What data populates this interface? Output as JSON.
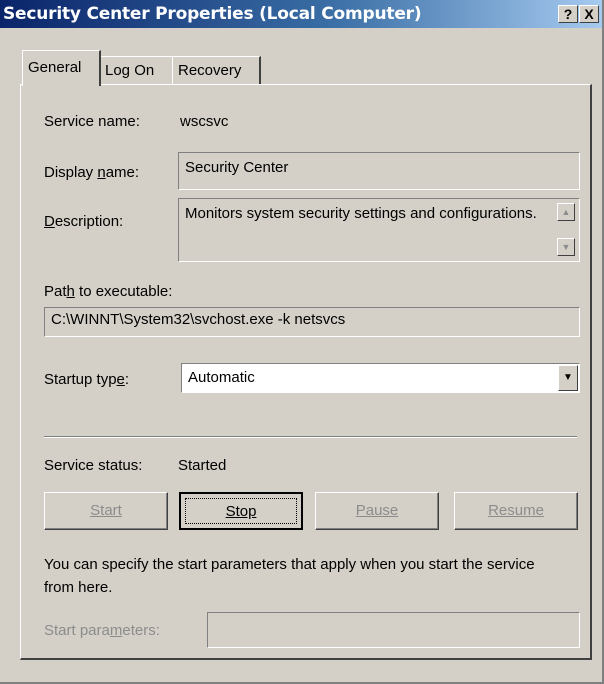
{
  "window": {
    "title": "Security Center Properties (Local Computer)",
    "help_button": "?",
    "close_button": "X"
  },
  "tabs": [
    {
      "label": "General",
      "active": true
    },
    {
      "label": "Log On",
      "active": false
    },
    {
      "label": "Recovery",
      "active": false
    }
  ],
  "general": {
    "service_name_label": "Service name:",
    "service_name_value": "wscsvc",
    "display_name_label": "Display name:",
    "display_name_value": "Security Center",
    "description_label": "Description:",
    "description_value": "Monitors system security settings and configurations.",
    "path_label": "Path to executable:",
    "path_value": "C:\\WINNT\\System32\\svchost.exe -k netsvcs",
    "startup_type_label": "Startup type:",
    "startup_type_value": "Automatic",
    "service_status_label": "Service status:",
    "service_status_value": "Started",
    "buttons": {
      "start": "Start",
      "stop": "Stop",
      "pause": "Pause",
      "resume": "Resume"
    },
    "help_text": "You can specify the start parameters that apply when you start the service from here.",
    "start_parameters_label": "Start parameters:",
    "start_parameters_value": ""
  },
  "icons": {
    "scroll_up": "up-arrow-icon",
    "scroll_down": "down-arrow-icon",
    "combo": "chevron-down-icon"
  }
}
